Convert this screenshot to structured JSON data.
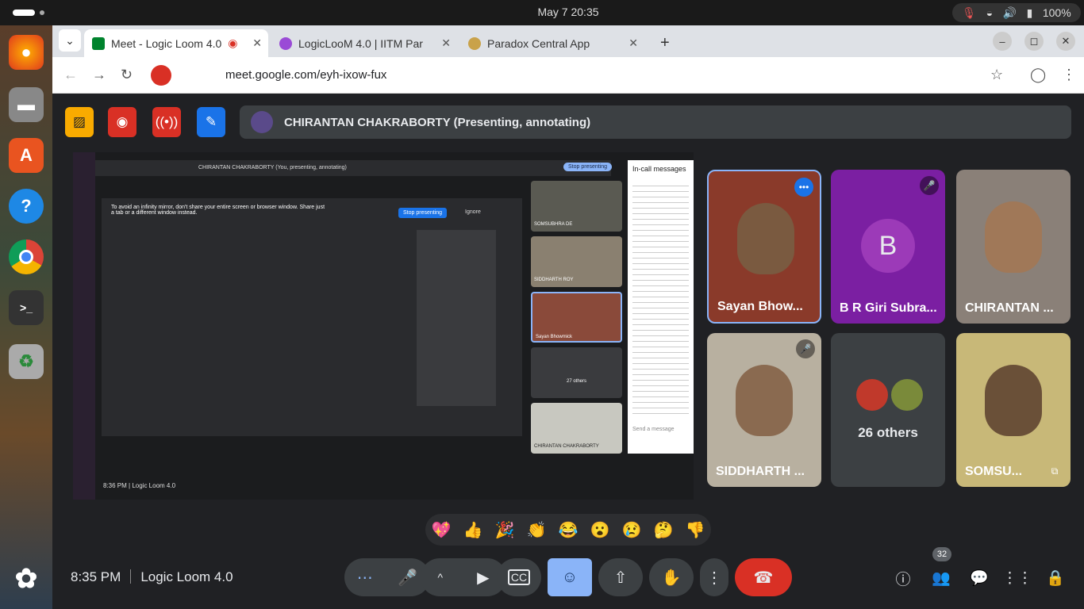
{
  "system": {
    "clock": "May 7  20:35",
    "battery": "100%"
  },
  "dock": {
    "apps": [
      "firefox-icon",
      "files-icon",
      "app-center-icon",
      "help-icon",
      "chrome-icon",
      "terminal-icon",
      "trash-icon",
      "show-apps-icon"
    ]
  },
  "browser": {
    "tabs": [
      {
        "title": "Meet - Logic Loom 4.0",
        "active": true
      },
      {
        "title": "LogicLooM 4.0 | IITM Par",
        "active": false
      },
      {
        "title": "Paradox Central App",
        "active": false
      }
    ],
    "url": "meet.google.com/eyh-ixow-fux"
  },
  "meet": {
    "presenter_banner": "CHIRANTAN CHAKRABORTY (Presenting, annotating)",
    "shared_screen": {
      "banner": "CHIRANTAN CHAKRABORTY (You, presenting, annotating)",
      "stop_button": "Stop presenting",
      "warning": "To avoid an infinity mirror, don't share your entire screen or browser window. Share just a tab or a different window instead.",
      "stop_presenting": "Stop presenting",
      "ignore": "Ignore",
      "messages_title": "In-call messages",
      "send_placeholder": "Send a message",
      "status": "8:36 PM  |  Logic Loom 4.0",
      "thumbs": [
        "SOMSUBHRA DE",
        "SIDDHARTH ROY",
        "Sayan Bhowmick",
        "27 others",
        "CHIRANTAN CHAKRABORTY"
      ]
    },
    "participants": [
      {
        "name": "Sayan Bhow...",
        "muted": false,
        "active": true
      },
      {
        "name": "B R Giri Subra...",
        "muted": true,
        "initial": "B"
      },
      {
        "name": "CHIRANTAN ...",
        "muted": false
      },
      {
        "name": "SIDDHARTH ...",
        "muted": true
      },
      {
        "name": "26 others",
        "muted": false
      },
      {
        "name": "SOMSU...",
        "muted": false
      }
    ],
    "reactions": [
      "💖",
      "👍",
      "🎉",
      "👏",
      "😂",
      "😮",
      "😢",
      "🤔",
      "👎"
    ],
    "time": "8:35 PM",
    "meeting_name": "Logic Loom 4.0",
    "people_count": "32"
  }
}
